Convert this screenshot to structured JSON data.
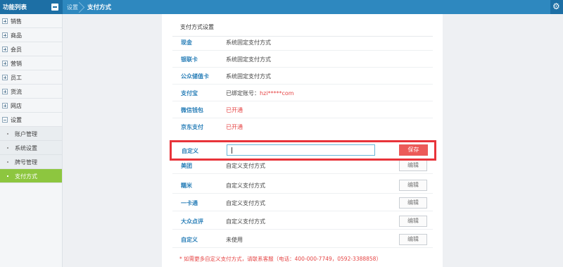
{
  "topbar": {
    "function_list_title": "功能列表",
    "breadcrumb_parent": "设置",
    "breadcrumb_current": "支付方式",
    "settings_icon": "gear-icon"
  },
  "sidebar": {
    "items": [
      {
        "label": "销售"
      },
      {
        "label": "商品"
      },
      {
        "label": "会员"
      },
      {
        "label": "营销"
      },
      {
        "label": "员工"
      },
      {
        "label": "货流"
      },
      {
        "label": "网店"
      },
      {
        "label": "设置"
      }
    ],
    "sub_items": [
      {
        "label": "账户管理"
      },
      {
        "label": "系统设置"
      },
      {
        "label": "牌号管理"
      },
      {
        "label": "支付方式"
      }
    ]
  },
  "panel": {
    "title": "支付方式设置",
    "rows_top": [
      {
        "name": "现金",
        "desc": "系统固定支付方式"
      },
      {
        "name": "银联卡",
        "desc": "系统固定支付方式"
      },
      {
        "name": "公众储值卡",
        "desc": "系统固定支付方式"
      },
      {
        "name": "支付宝",
        "desc_prefix": "已绑定账号：",
        "desc_account": "hzi*****com"
      },
      {
        "name": "微信钱包",
        "desc": "已开通"
      },
      {
        "name": "京东支付",
        "desc": "已开通"
      }
    ],
    "custom_row": {
      "name": "自定义",
      "input_value": "",
      "save_label": "保存"
    },
    "rows_bottom": [
      {
        "name": "美团",
        "desc": "自定义支付方式",
        "edit_label": "编辑"
      },
      {
        "name": "糯米",
        "desc": "自定义支付方式",
        "edit_label": "编辑"
      },
      {
        "name": "一卡通",
        "desc": "自定义支付方式",
        "edit_label": "编辑"
      },
      {
        "name": "大众点评",
        "desc": "自定义支付方式",
        "edit_label": "编辑"
      },
      {
        "name": "自定义",
        "desc": "未使用",
        "edit_label": "编辑"
      }
    ],
    "note": "* 如需更多自定义支付方式，请联系客服（电话：400-000-7749，0592-3388858）"
  },
  "colors": {
    "topbar": "#2e88bf",
    "active_sub_item": "#8dc63f",
    "link_blue": "#2a7fb8",
    "alert_red": "#e64545",
    "highlight_border": "#e8343a",
    "save_button": "#ec5a58"
  }
}
